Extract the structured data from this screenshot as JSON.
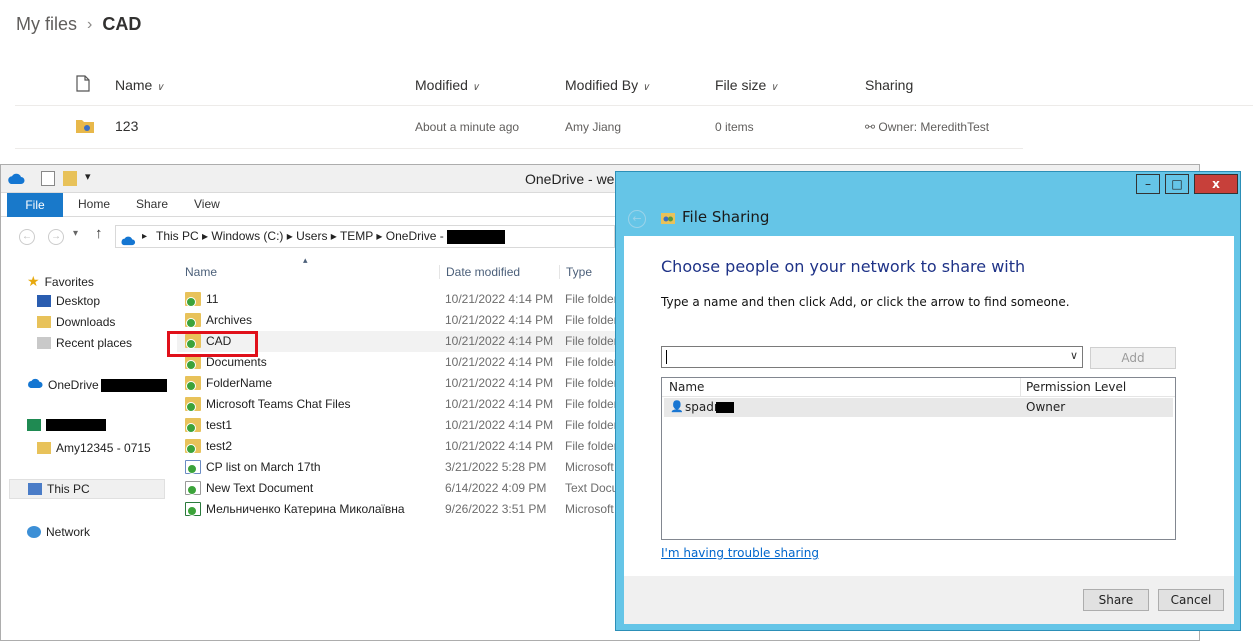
{
  "web": {
    "breadcrumb_root": "My files",
    "breadcrumb_current": "CAD",
    "columns": {
      "name": "Name",
      "modified": "Modified",
      "modified_by": "Modified By",
      "file_size": "File size",
      "sharing": "Sharing"
    },
    "row": {
      "name": "123",
      "modified": "About a minute ago",
      "modified_by": "Amy Jiang",
      "file_size": "0 items",
      "sharing": "Owner: MeredithTest"
    }
  },
  "explorer": {
    "title": "OneDrive - we",
    "ribbon": {
      "file": "File",
      "home": "Home",
      "share": "Share",
      "view": "View"
    },
    "address": [
      "This PC",
      "Windows (C:)",
      "Users",
      "TEMP",
      "OneDrive - "
    ],
    "nav": {
      "favorites": "Favorites",
      "desktop": "Desktop",
      "downloads": "Downloads",
      "recent": "Recent places",
      "onedrive": "OneDrive",
      "amy": "Amy12345 - 0715",
      "thispc": "This PC",
      "network": "Network"
    },
    "columns": {
      "name": "Name",
      "date": "Date modified",
      "type": "Type"
    },
    "files": [
      {
        "name": "11",
        "date": "10/21/2022 4:14 PM",
        "type": "File folder"
      },
      {
        "name": "Archives",
        "date": "10/21/2022 4:14 PM",
        "type": "File folder"
      },
      {
        "name": "CAD",
        "date": "10/21/2022 4:14 PM",
        "type": "File folder"
      },
      {
        "name": "Documents",
        "date": "10/21/2022 4:14 PM",
        "type": "File folder"
      },
      {
        "name": "FolderName",
        "date": "10/21/2022 4:14 PM",
        "type": "File folder"
      },
      {
        "name": "Microsoft Teams Chat Files",
        "date": "10/21/2022 4:14 PM",
        "type": "File folder"
      },
      {
        "name": "test1",
        "date": "10/21/2022 4:14 PM",
        "type": "File folder"
      },
      {
        "name": "test2",
        "date": "10/21/2022 4:14 PM",
        "type": "File folder"
      },
      {
        "name": "CP list on March 17th",
        "date": "3/21/2022 5:28 PM",
        "type": "Microsoft"
      },
      {
        "name": "New Text Document",
        "date": "6/14/2022 4:09 PM",
        "type": "Text Docu"
      },
      {
        "name": "Мельниченко Катерина Миколаївна",
        "date": "9/26/2022 3:51 PM",
        "type": "Microsoft"
      }
    ]
  },
  "dialog": {
    "title": "File Sharing",
    "heading": "Choose people on your network to share with",
    "instruction": "Type a name and then click Add, or click the arrow to find someone.",
    "add_label": "Add",
    "table_name": "Name",
    "table_perm": "Permission Level",
    "user_name": "spadr",
    "user_perm": "Owner",
    "trouble_link": "I'm having trouble sharing",
    "share_label": "Share",
    "cancel_label": "Cancel",
    "close_glyph": "x"
  },
  "colors": {
    "highlight": "#e0101a",
    "dialog_frame": "#65c5e7",
    "link": "#0066cc",
    "heading": "#1e3287"
  }
}
